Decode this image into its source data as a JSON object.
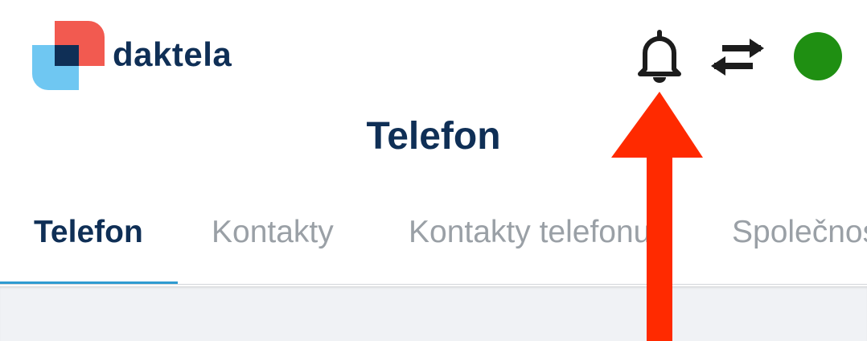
{
  "header": {
    "brand_name": "daktela",
    "icons": {
      "logo": "daktela-logo",
      "notifications": "bell-icon",
      "switch": "swap-arrows-icon",
      "status": "status-dot"
    },
    "status_color": "#1f8f12"
  },
  "page": {
    "title": "Telefon"
  },
  "tabs": [
    {
      "label": "Telefon",
      "active": true
    },
    {
      "label": "Kontakty",
      "active": false
    },
    {
      "label": "Kontakty telefonu",
      "active": false
    },
    {
      "label": "Společnosti",
      "active": false
    }
  ],
  "annotation": {
    "type": "arrow",
    "color": "#ff2a00",
    "points_to": "bell-icon"
  },
  "colors": {
    "primary_text": "#0f2f56",
    "inactive_tab": "#9aa0a6",
    "tab_indicator": "#2f9bd1",
    "content_bg": "#f0f2f5"
  }
}
